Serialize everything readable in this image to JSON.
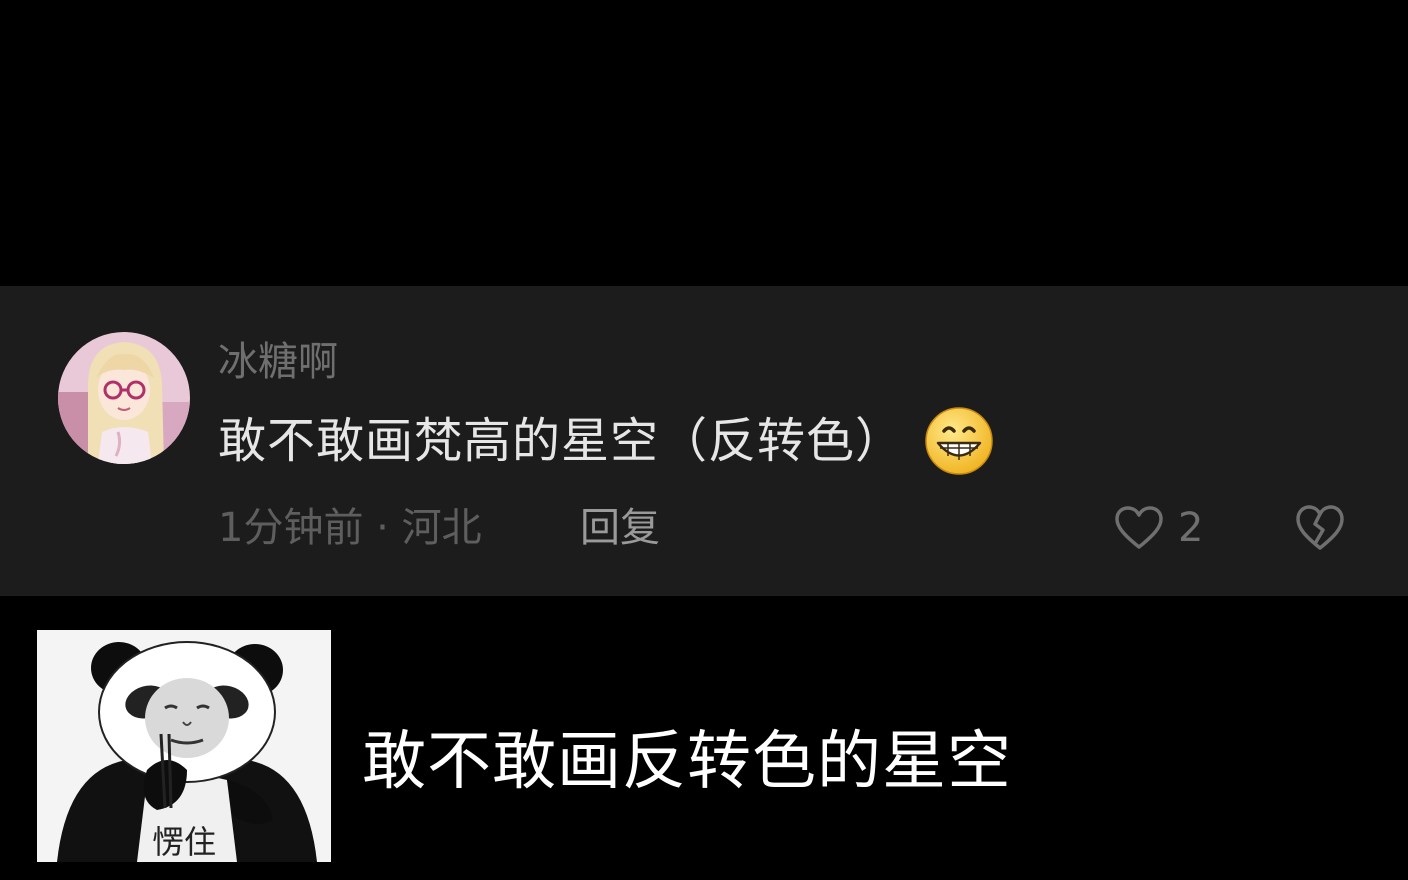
{
  "comment": {
    "username": "冰糖啊",
    "text": "敢不敢画梵高的星空（反转色）",
    "emoji_icon": "grinning-face-icon",
    "time_location": "1分钟前 · 河北",
    "reply_label": "回复",
    "like_count": "2",
    "like_icon": "heart-outline-icon",
    "dislike_icon": "broken-heart-icon"
  },
  "meme": {
    "caption": "愣住",
    "icon": "panda-meme-image"
  },
  "subtitle": "敢不敢画反转色的星空",
  "colors": {
    "page_background": "#000000",
    "card_background": "#1c1c1c",
    "username": "#6f6f6f",
    "comment_text": "#e6e6e6",
    "meta_text": "#5e5e5e",
    "reply_text": "#9a9a9a",
    "subtitle": "#ffffff"
  }
}
